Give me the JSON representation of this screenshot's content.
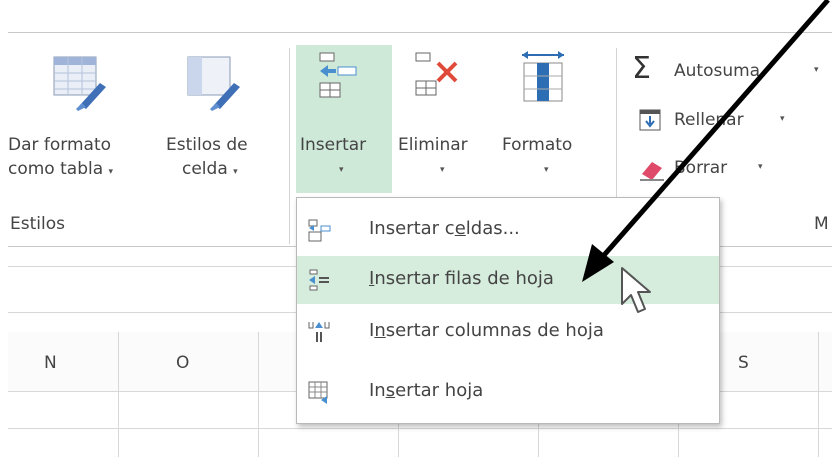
{
  "ribbon": {
    "dar_formato": {
      "line1": "Dar formato",
      "line2": "como tabla"
    },
    "estilos_celda": {
      "line1": "Estilos de",
      "line2": "celda"
    },
    "insertar": "Insertar",
    "eliminar": "Eliminar",
    "formato": "Formato",
    "autosuma": "Autosuma",
    "rellenar": "Rellenar",
    "borrar": "Borrar",
    "group_estilos": "Estilos",
    "group_m": "M"
  },
  "columns": [
    "N",
    "O",
    "S"
  ],
  "menu": {
    "items": [
      {
        "pre": "Insertar c",
        "key": "e",
        "post": "ldas..."
      },
      {
        "pre": "",
        "key": "I",
        "post": "nsertar filas de hoja"
      },
      {
        "pre": "I",
        "key": "n",
        "post": "sertar columnas de hoja"
      },
      {
        "pre": "In",
        "key": "s",
        "post": "ertar hoja"
      }
    ]
  },
  "colors": {
    "highlight": "#cfe9d9",
    "accent_red": "#e04a3a",
    "accent_blue": "#2d6db4"
  }
}
